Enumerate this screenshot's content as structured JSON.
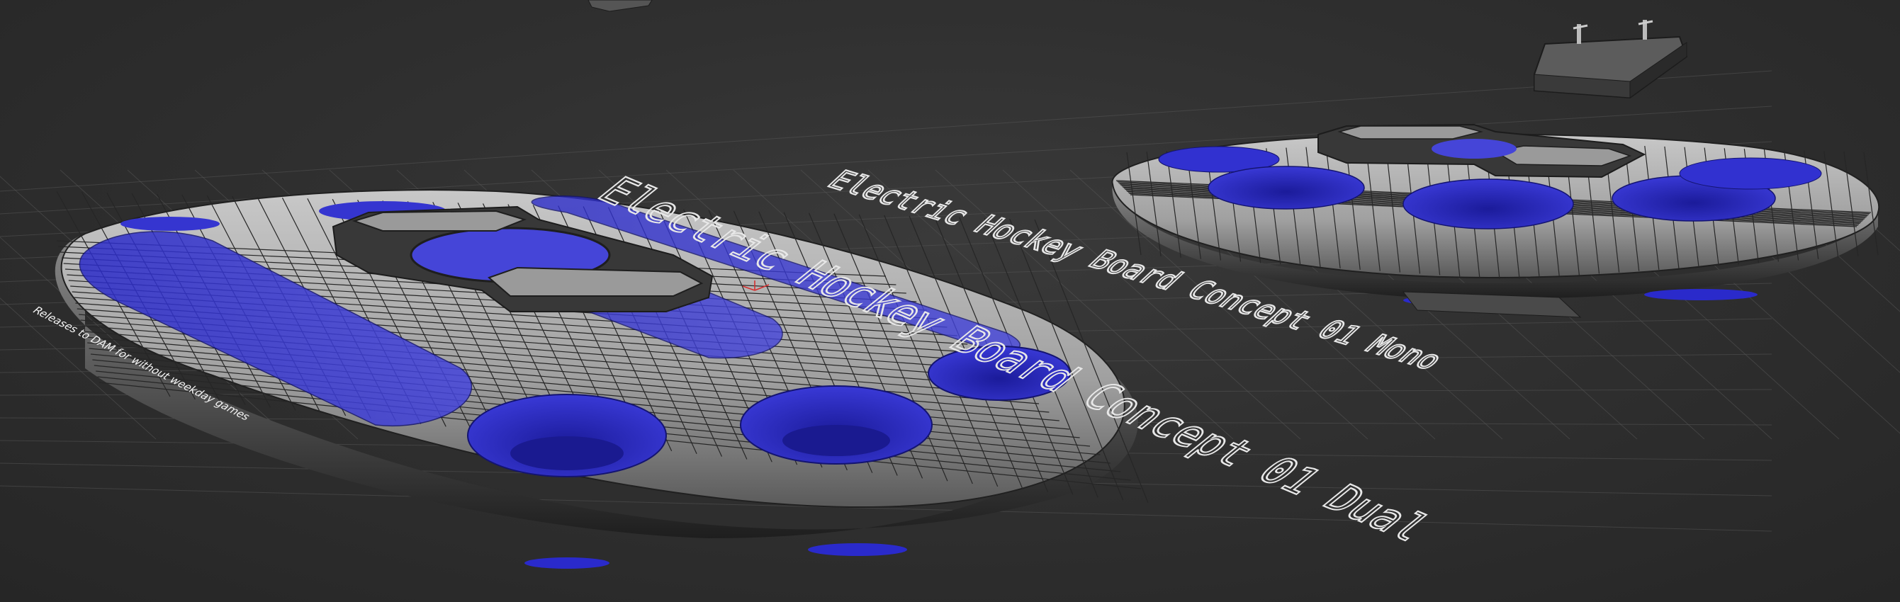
{
  "viewport": {
    "background": "#2e2e2e",
    "texts": {
      "dual_title": "Electric Hockey Board Concept 01 Dual",
      "mono_title": "Electric Hockey Board Concept 01 Mono",
      "side_note": "Releases to DAM for without weekday games"
    }
  },
  "colors": {
    "mesh_surface": "#a9a9a9",
    "mesh_wire": "#262626",
    "pocket_fill": "#2a2acb",
    "controller_fill": "#3a3a3a",
    "controller_button": "#9a9a9a",
    "text_stroke": "#e8e8e8",
    "gizmo_red": "#d43030"
  },
  "icons": {
    "pivot_gizmo": "axis-gizmo-icon"
  }
}
